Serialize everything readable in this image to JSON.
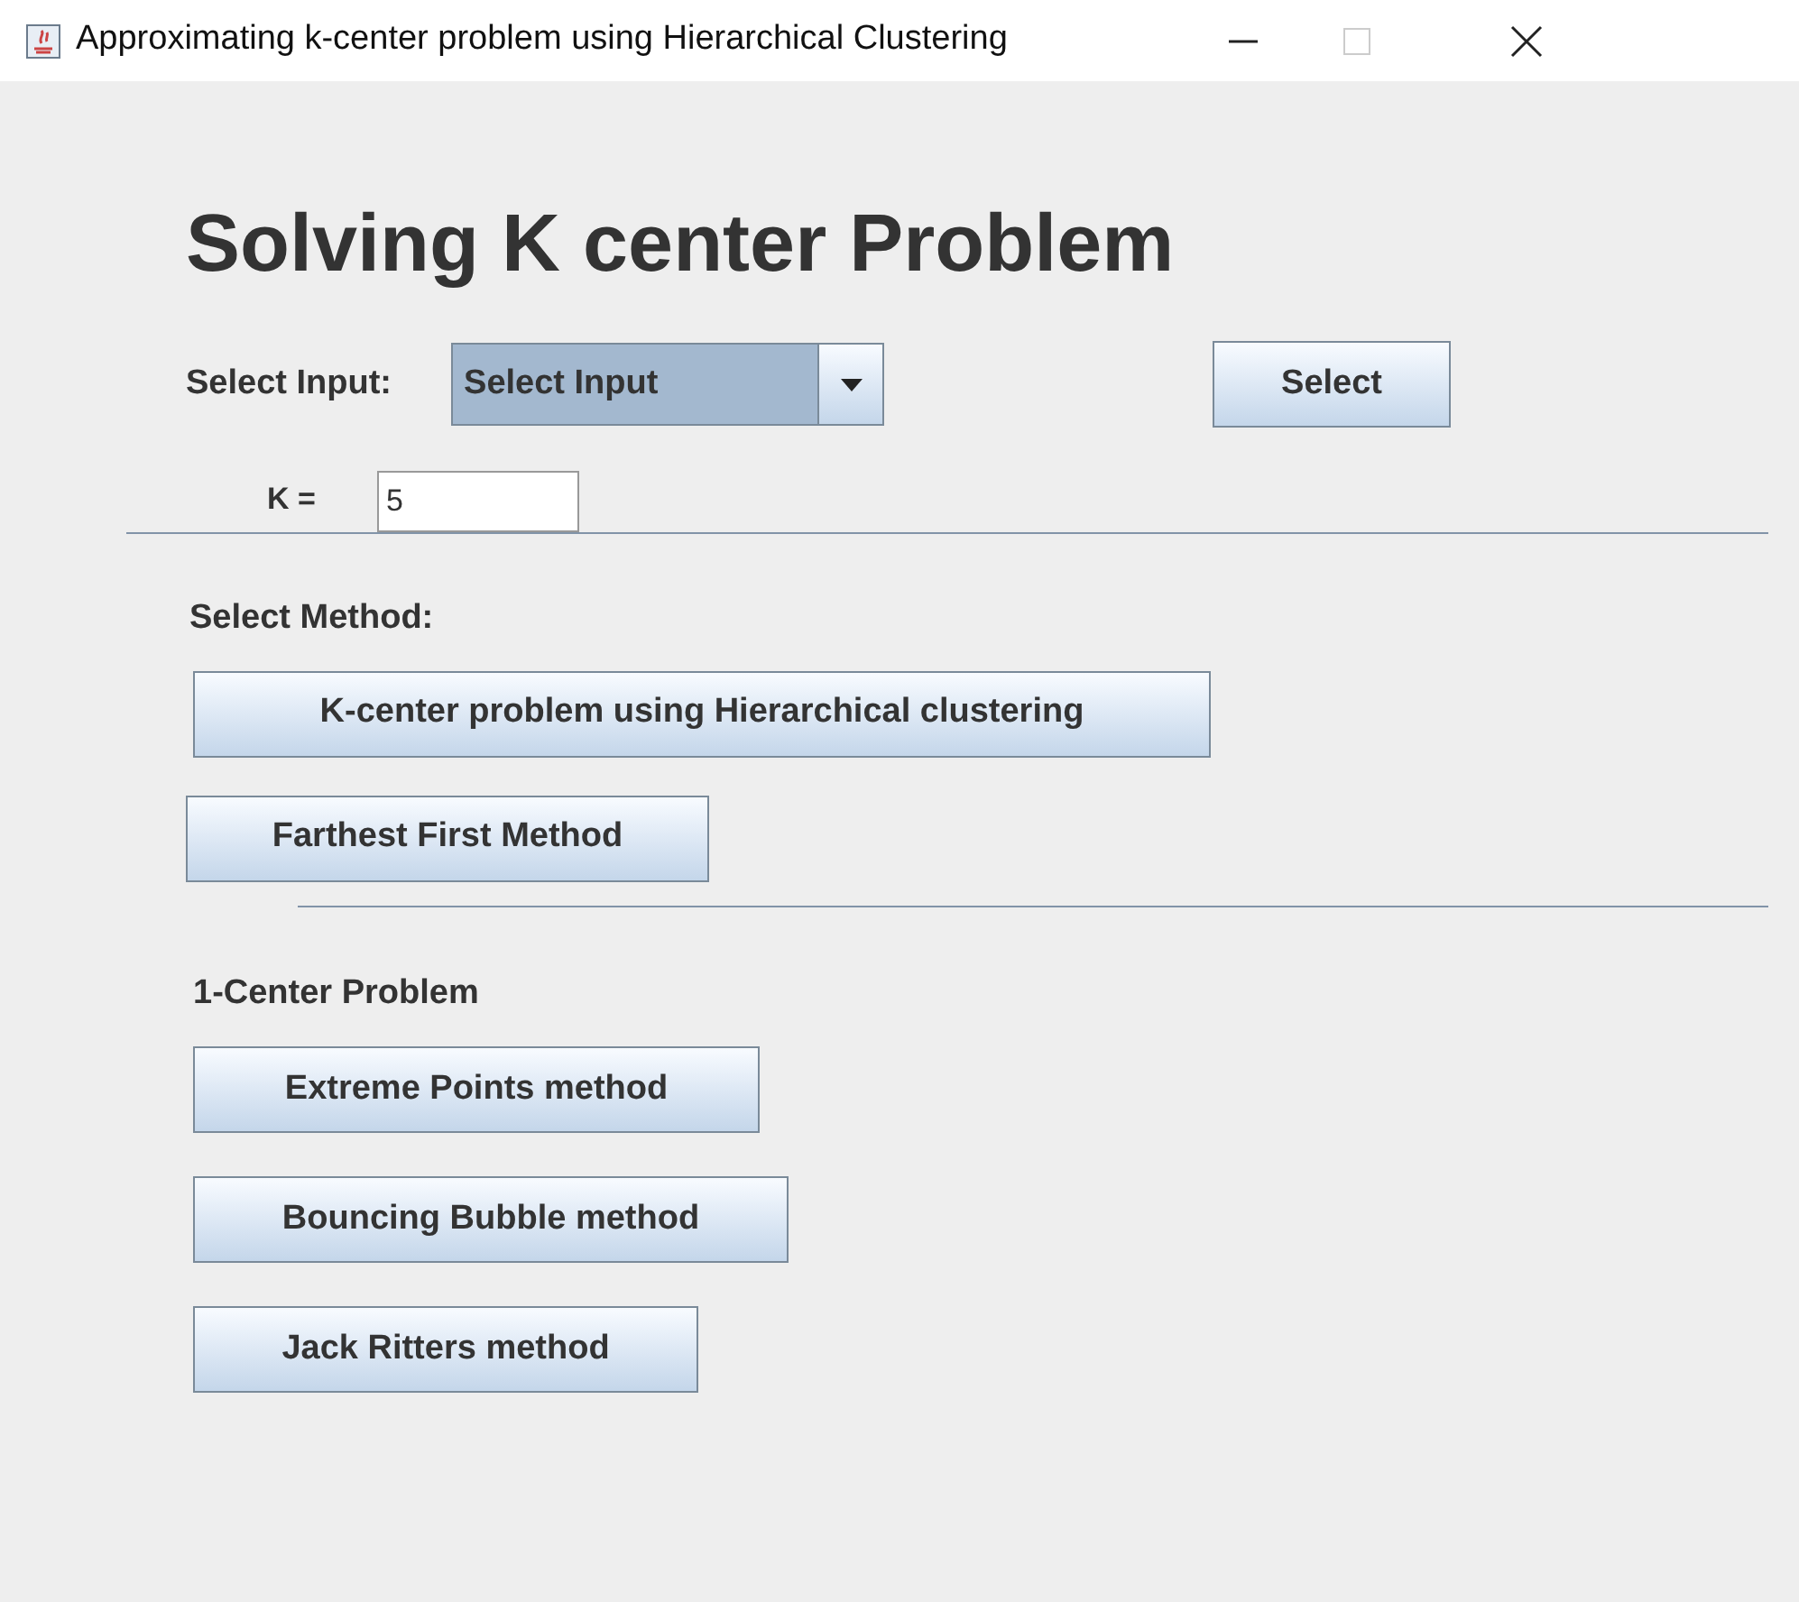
{
  "window": {
    "title": "Approximating k-center problem using Hierarchical Clustering"
  },
  "heading": "Solving K center Problem",
  "input_row": {
    "label": "Select Input:",
    "dropdown_value": "Select Input",
    "button": "Select"
  },
  "k_field": {
    "label": "K =",
    "value": "5"
  },
  "method_section": {
    "label": "Select Method:",
    "buttons": [
      "K-center problem using Hierarchical clustering",
      "Farthest First Method"
    ]
  },
  "one_center_section": {
    "label": "1-Center Problem",
    "buttons": [
      "Extreme Points method",
      "Bouncing Bubble method",
      "Jack Ritters method"
    ]
  }
}
